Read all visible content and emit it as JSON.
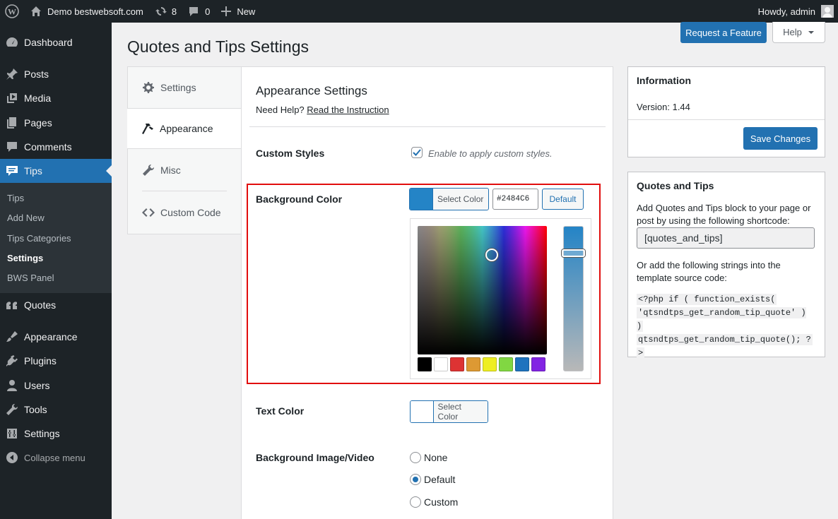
{
  "adminbar": {
    "site_name": "Demo bestwebsoft.com",
    "updates_count": "8",
    "comments_count": "0",
    "new_label": "New",
    "howdy": "Howdy, admin"
  },
  "sidebar": {
    "items": [
      {
        "label": "Dashboard",
        "icon": "dashboard-icon"
      },
      {
        "label": "Posts",
        "icon": "pin-icon"
      },
      {
        "label": "Media",
        "icon": "media-icon"
      },
      {
        "label": "Pages",
        "icon": "pages-icon"
      },
      {
        "label": "Comments",
        "icon": "comment-icon"
      },
      {
        "label": "Tips",
        "icon": "tips-icon"
      },
      {
        "label": "Quotes",
        "icon": "quote-icon"
      },
      {
        "label": "Appearance",
        "icon": "brush-icon"
      },
      {
        "label": "Plugins",
        "icon": "plugin-icon"
      },
      {
        "label": "Users",
        "icon": "users-icon"
      },
      {
        "label": "Tools",
        "icon": "wrench-icon"
      },
      {
        "label": "Settings",
        "icon": "settings-icon"
      },
      {
        "label": "Collapse menu",
        "icon": "collapse-icon"
      }
    ],
    "submenu": [
      "Tips",
      "Add New",
      "Tips Categories",
      "Settings",
      "BWS Panel"
    ]
  },
  "header": {
    "title": "Quotes and Tips Settings",
    "request_feature": "Request a Feature",
    "help": "Help"
  },
  "tabs": [
    {
      "label": "Settings",
      "icon": "gear-icon"
    },
    {
      "label": "Appearance",
      "icon": "hammer-icon"
    },
    {
      "label": "Misc",
      "icon": "wrench-icon"
    },
    {
      "label": "Custom Code",
      "icon": "code-icon"
    }
  ],
  "main": {
    "section_title": "Appearance Settings",
    "need_help": "Need Help?",
    "instruction_link": "Read the Instruction",
    "custom_styles": {
      "label": "Custom Styles",
      "checked": true,
      "description": "Enable to apply custom styles."
    },
    "background_color": {
      "label": "Background Color",
      "select_label": "Select Color",
      "value": "#2484C6",
      "default_label": "Default",
      "palette": [
        "#000000",
        "#ffffff",
        "#dd3333",
        "#dd9933",
        "#eeee22",
        "#81d742",
        "#1e73be",
        "#8224e3"
      ]
    },
    "text_color": {
      "label": "Text Color",
      "select_label": "Select Color"
    },
    "background_media": {
      "label": "Background Image/Video",
      "options": [
        "None",
        "Default",
        "Custom"
      ],
      "selected": "Default"
    }
  },
  "info_box": {
    "title": "Information",
    "version": "Version: 1.44",
    "save": "Save Changes"
  },
  "shortcode_box": {
    "title": "Quotes and Tips",
    "text1_line1": "Add Quotes and Tips block to your page or",
    "text1_line2": "post by using the following shortcode:",
    "shortcode": "[quotes_and_tips]",
    "text2_line1": "Or add the following strings into the",
    "text2_line2": "template source code:",
    "code_line1": " <?php if ( function_exists(",
    "code_line2": "'qtsndtps_get_random_tip_quote' ) )",
    "code_line3": "qtsndtps_get_random_tip_quote(); ?",
    "code_line4": ">"
  },
  "colors": {
    "accent": "#2271b1",
    "selected_color": "#2484c6",
    "highlight": "#e10d0d"
  }
}
